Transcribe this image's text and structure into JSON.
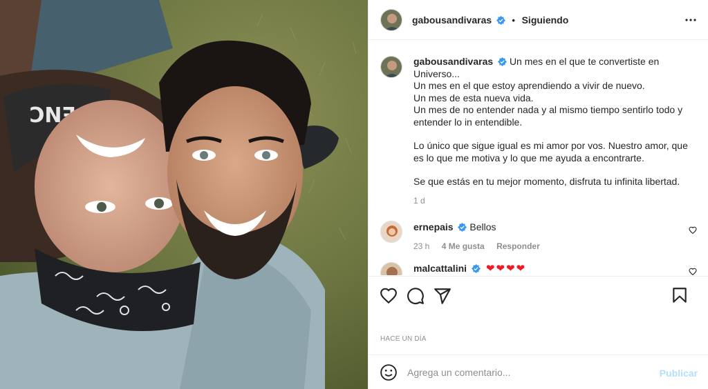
{
  "post": {
    "image_alt": "Selfie de una pareja acostada sobre el pasto"
  },
  "header": {
    "username": "gabousandivaras",
    "separator": "•",
    "follow_status": "Siguiendo",
    "more_icon": "more-horizontal-icon"
  },
  "caption": {
    "username": "gabousandivaras",
    "lines": [
      "Un mes en el que te convertiste en Universo...",
      "Un mes en el que estoy aprendiendo a vivir de nuevo.",
      "Un mes de esta nueva vida.",
      "Un mes de no entender nada y al mismo tiempo sentirlo todo y entender lo in entendible.",
      "Lo único que sigue igual es mi amor por vos. Nuestro amor, que es lo que me motiva y lo que me ayuda a encontrarte.",
      "Se que estás en tu mejor momento, disfruta tu infinita libertad."
    ],
    "time": "1 d"
  },
  "comments": [
    {
      "username": "ernepais",
      "text": "Bellos",
      "time": "23 h",
      "likes": "4 Me gusta",
      "reply": "Responder"
    },
    {
      "username": "malcattalini",
      "text": "❤❤❤❤"
    }
  ],
  "actions": {
    "like_icon": "heart-icon",
    "comment_icon": "comment-icon",
    "share_icon": "paper-plane-icon",
    "save_icon": "bookmark-icon"
  },
  "date_label": "HACE UN DÍA",
  "add_comment": {
    "placeholder": "Agrega un comentario...",
    "publish_label": "Publicar"
  },
  "colors": {
    "verified": "#3897f0",
    "publish_disabled": "#b2dffc",
    "secondary_text": "#8e8e8e",
    "heart_red": "#ed1c24"
  }
}
